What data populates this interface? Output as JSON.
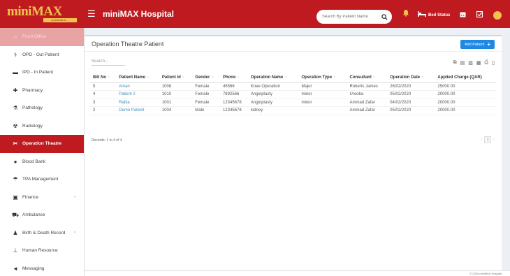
{
  "app": {
    "logo_text": "miniMAX",
    "logo_sub": "a product of ...",
    "title": "miniMAX Hospital"
  },
  "topbar": {
    "search_placeholder": "Search By Patient Name",
    "bed_status_label": "Bed Status"
  },
  "sidebar": {
    "items": [
      {
        "label": "Front Office",
        "icon": "home-icon"
      },
      {
        "label": "OPD - Out Patient",
        "icon": "stethoscope-icon"
      },
      {
        "label": "IPD - In Patient",
        "icon": "bed-icon"
      },
      {
        "label": "Pharmacy",
        "icon": "pill-icon"
      },
      {
        "label": "Pathology",
        "icon": "flask-icon"
      },
      {
        "label": "Radiology",
        "icon": "xray-icon"
      },
      {
        "label": "Operation Theatre",
        "icon": "scissors-icon"
      },
      {
        "label": "Blood Bank",
        "icon": "blood-drop-icon"
      },
      {
        "label": "TPA Management",
        "icon": "umbrella-icon"
      },
      {
        "label": "Finance",
        "icon": "money-icon"
      },
      {
        "label": "Ambulance",
        "icon": "ambulance-icon"
      },
      {
        "label": "Birth & Death Record",
        "icon": "family-icon"
      },
      {
        "label": "Human Resource",
        "icon": "sitemap-icon"
      },
      {
        "label": "Messaging",
        "icon": "bullhorn-icon"
      }
    ]
  },
  "panel": {
    "title": "Operation Theatre Patient",
    "add_button": "Add Patient",
    "search_placeholder": "Search...",
    "columns": [
      "Bill No",
      "Patient Name",
      "Patient Id",
      "Gender",
      "Phone",
      "Operation Name",
      "Operation Type",
      "Consultant",
      "Operation Date",
      "Applied Charge (QAR)"
    ],
    "rows": [
      [
        "5",
        "Aman",
        "1008",
        "Female",
        "45566",
        "Knee Operation",
        "Major",
        "Roberts James",
        "26/02/2020",
        "25000.00"
      ],
      [
        "4",
        "Patient 2",
        "1010",
        "Female",
        "7892566",
        "Angioplasty",
        "minor",
        "Urooba",
        "05/02/2020",
        "20000.00"
      ],
      [
        "3",
        "Rabia",
        "1001",
        "Female",
        "12345678",
        "Angioplasty",
        "minor",
        "Ammad Zafar",
        "04/02/2020",
        "20000.00"
      ],
      [
        "2",
        "Demo Patient",
        "1004",
        "Male",
        "12345678",
        "kidney",
        "",
        "Ammad Zafar",
        "05/02/2020",
        "20000.00"
      ]
    ],
    "records_text": "Records: 1 to 4 of 4",
    "page_number": "1"
  },
  "footer": {
    "text": "© 2020 miniMAX Hospital"
  }
}
